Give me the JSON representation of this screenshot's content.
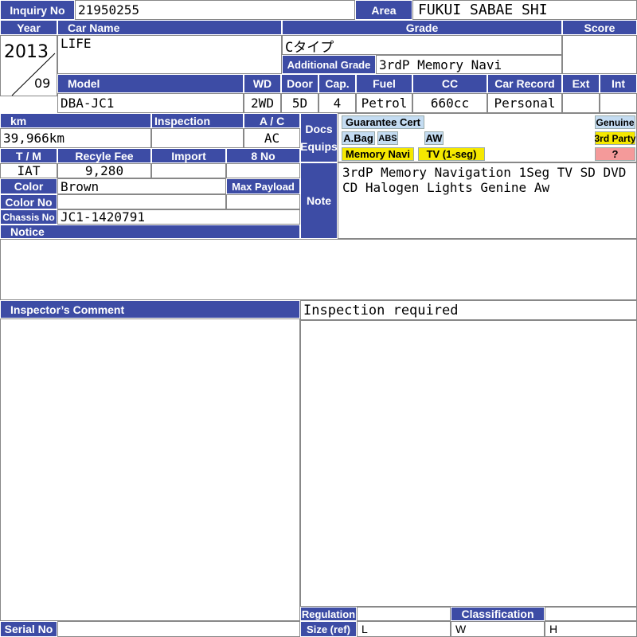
{
  "colors": {
    "header_bg": "#3d4ca5",
    "header_text": "#ffffff",
    "tag_blue": "#c4dcf2",
    "tag_yellow": "#f5e800",
    "tag_pink": "#f49a9a"
  },
  "labels": {
    "inquiry_no": "Inquiry No",
    "area": "Area",
    "year": "Year",
    "car_name": "Car Name",
    "grade": "Grade",
    "score": "Score",
    "additional_grade": "Additional Grade",
    "model": "Model",
    "wd": "WD",
    "door": "Door",
    "cap": "Cap.",
    "fuel": "Fuel",
    "cc": "CC",
    "car_record": "Car Record",
    "ext": "Ext",
    "int": "Int",
    "km": "km",
    "inspection": "Inspection",
    "ac": "A / C",
    "docs": "Docs",
    "equips": "Equips",
    "tm": "T / M",
    "recycle_fee": "Recyle Fee",
    "import": "Import",
    "eight_no": "8 No",
    "note": "Note",
    "color": "Color",
    "max_payload": "Max Payload",
    "color_no": "Color No",
    "chassis_no": "Chassis No",
    "notice": "Notice",
    "inspectors_comment": "Inspector’s Comment",
    "regulation": "Regulation",
    "classification": "Classification",
    "serial_no": "Serial No",
    "size_ref": "Size (ref)",
    "size_l": "L",
    "size_w": "W",
    "size_h": "H"
  },
  "values": {
    "inquiry_no": "21950255",
    "area": "FUKUI SABAE SHI",
    "year": "2013",
    "month": "09",
    "car_name": "LIFE",
    "grade": "Cタイプ",
    "score": "",
    "additional_grade": "3rdP Memory Navi",
    "model": "DBA-JC1",
    "wd": "2WD",
    "door": "5D",
    "cap": "4",
    "fuel": "Petrol",
    "cc": "660cc",
    "car_record": "Personal",
    "ext": "",
    "int": "",
    "km": "39,966km",
    "inspection": "",
    "ac": "AC",
    "tm": "IAT",
    "recycle_fee": "9,280",
    "import": "",
    "eight_no": "",
    "note_line1": "3rdP Memory Navigation 1Seg TV SD DVD",
    "note_line2": "CD Halogen Lights Genine Aw",
    "color": "Brown",
    "max_payload": "",
    "color_no": "",
    "chassis_no": "JC1-1420791",
    "notice": "",
    "comment_right": "Inspection required",
    "regulation": "",
    "classification": "",
    "serial_no": "",
    "size_l": "",
    "size_w": "",
    "size_h": ""
  },
  "tags": {
    "guarantee_cert": "Guarantee Cert",
    "abag": "A.Bag",
    "abs": "ABS",
    "aw": "AW",
    "memory_navi": "Memory Navi",
    "tv": "TV (1-seg)",
    "genuine": "Genuine",
    "third_party": "3rd Party",
    "unknown": "?"
  }
}
